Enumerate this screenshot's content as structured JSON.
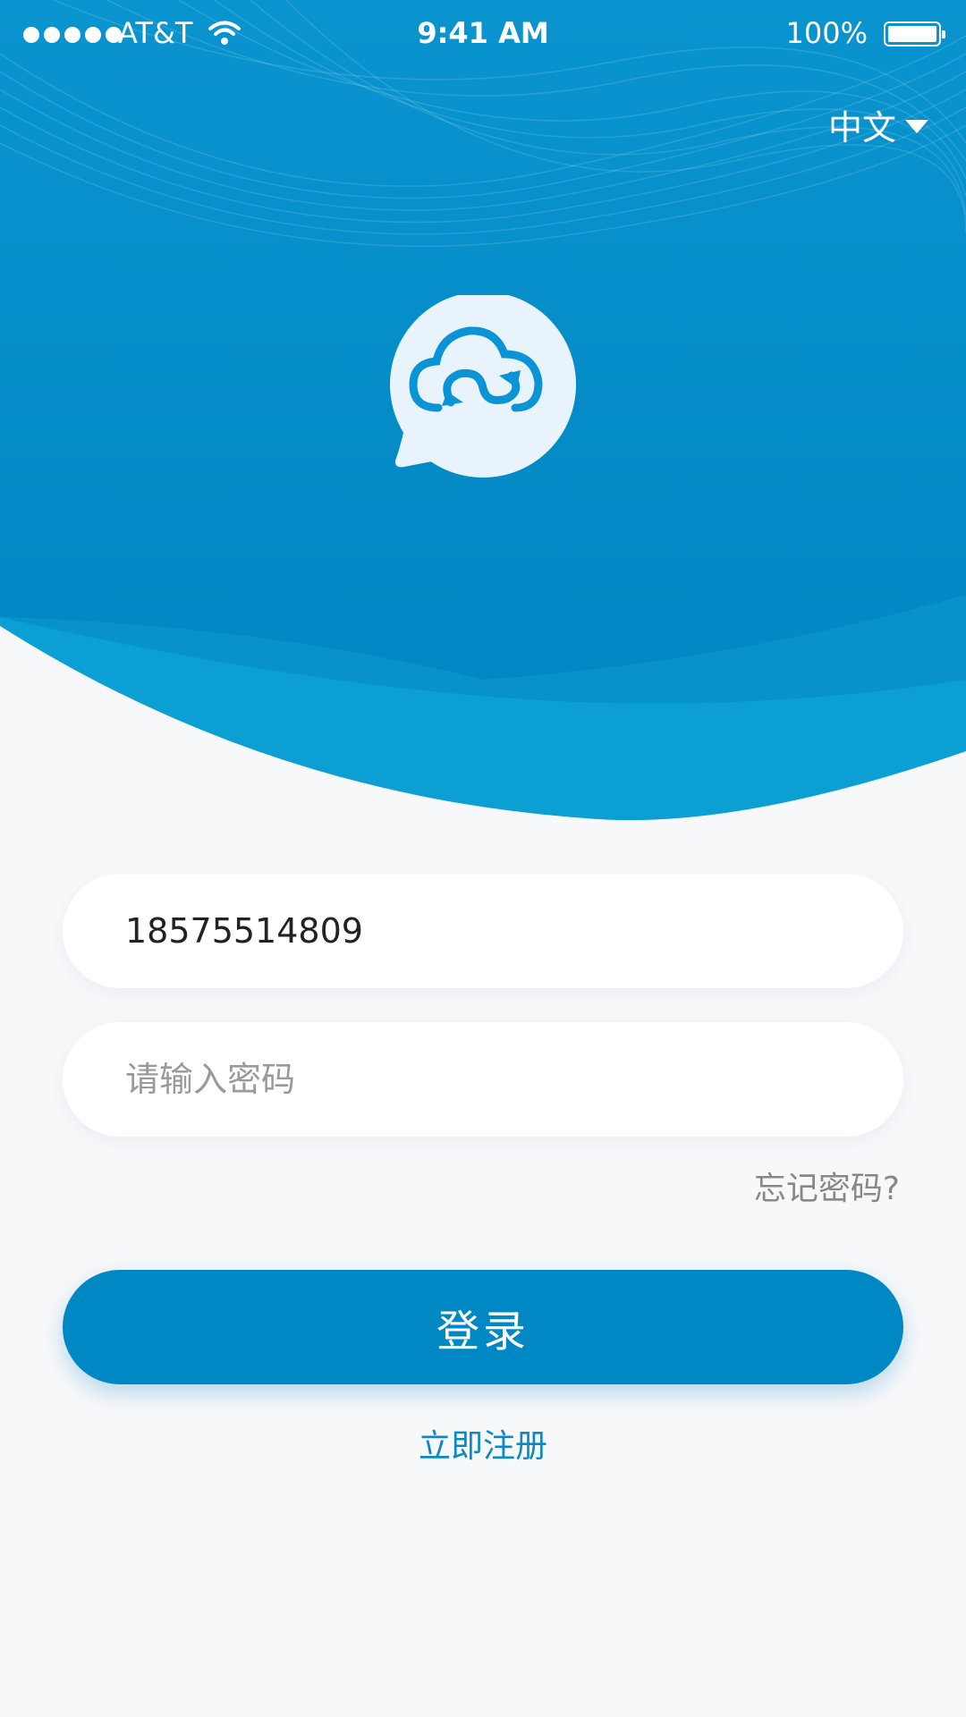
{
  "status_bar": {
    "carrier": "AT&T",
    "time": "9:41 AM",
    "battery_percent": "100%",
    "battery_level": 1.0,
    "signal_bars": 5
  },
  "header": {
    "language_label": "中文",
    "language_icon": "chevron-down-icon",
    "logo_icon": "cloud-sync-chat-icon"
  },
  "form": {
    "phone_value": "18575514809",
    "password_placeholder": "请输入密码",
    "forgot_label": "忘记密码?",
    "login_label": "登录",
    "register_label": "立即注册"
  },
  "colors": {
    "primary": "#0088c4",
    "hero_light": "#0b9fd3",
    "background": "#f7f8fa",
    "link": "#0a88c8"
  }
}
